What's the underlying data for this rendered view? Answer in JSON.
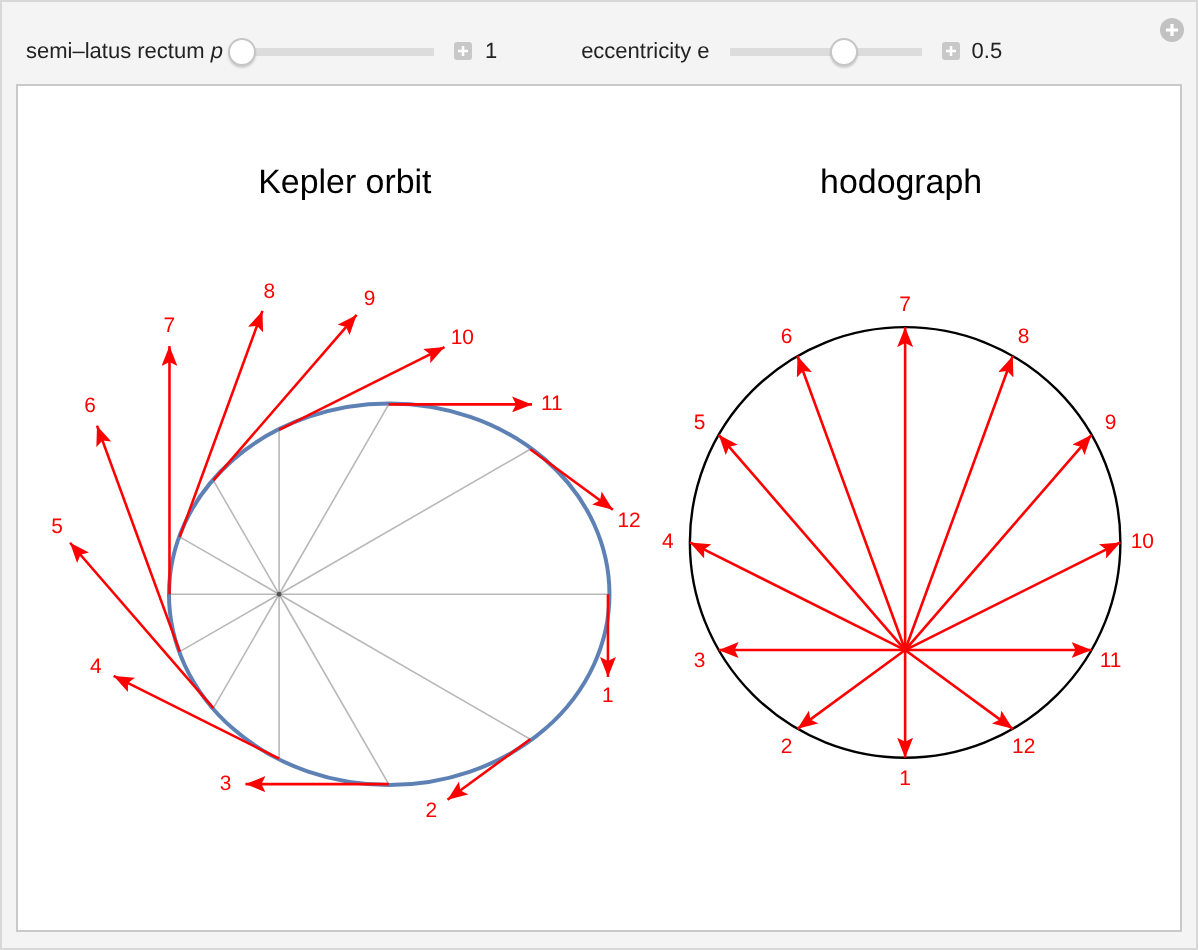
{
  "controls": [
    {
      "label": "semi–latus rectum *p*",
      "level": 0,
      "value": "1"
    },
    {
      "label": "eccentricity e",
      "level": 0.6,
      "value": "0.5"
    }
  ],
  "plots": [
    {
      "kind": "orbit",
      "title": "Kepler orbit",
      "labels": [
        "1",
        "2",
        "3",
        "4",
        "5",
        "6",
        "7",
        "8",
        "9",
        "10",
        "11",
        "12"
      ]
    },
    {
      "kind": "hodograph",
      "title": "hodograph",
      "labels": [
        "1",
        "2",
        "3",
        "4",
        "5",
        "6",
        "7",
        "8",
        "9",
        "10",
        "11",
        "12"
      ]
    }
  ]
}
